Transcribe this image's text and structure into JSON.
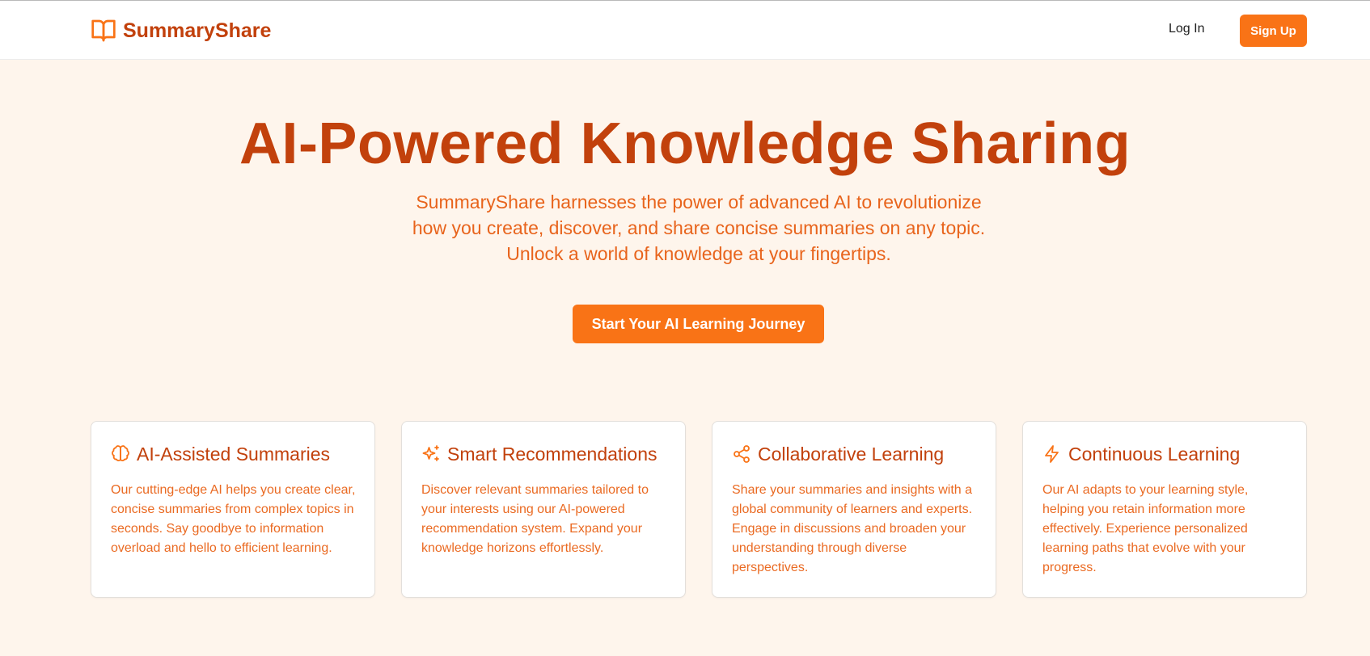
{
  "brand": {
    "name": "SummaryShare",
    "icon": "open-book-icon",
    "color": "#c2410c"
  },
  "nav": {
    "login_label": "Log In",
    "signup_label": "Sign Up"
  },
  "hero": {
    "title": "AI-Powered Knowledge Sharing",
    "subtitle": "SummaryShare harnesses the power of advanced AI to revolutionize how you create, discover, and share concise summaries on any topic. Unlock a world of knowledge at your fingertips.",
    "cta_label": "Start Your AI Learning Journey"
  },
  "features": [
    {
      "icon": "brain-icon",
      "title": "AI-Assisted Summaries",
      "description": "Our cutting-edge AI helps you create clear, concise summaries from complex topics in seconds. Say goodbye to information overload and hello to efficient learning."
    },
    {
      "icon": "sparkles-icon",
      "title": "Smart Recommendations",
      "description": "Discover relevant summaries tailored to your interests using our AI-powered recommendation system. Expand your knowledge horizons effortlessly."
    },
    {
      "icon": "share-icon",
      "title": "Collaborative Learning",
      "description": "Share your summaries and insights with a global community of learners and experts. Engage in discussions and broaden your understanding through diverse perspectives."
    },
    {
      "icon": "lightning-icon",
      "title": "Continuous Learning",
      "description": "Our AI adapts to your learning style, helping you retain information more effectively. Experience personalized learning paths that evolve with your progress."
    }
  ],
  "colors": {
    "accent": "#f97316",
    "heading": "#c2410c",
    "text": "#ea6a22",
    "background": "#fef5ec"
  }
}
